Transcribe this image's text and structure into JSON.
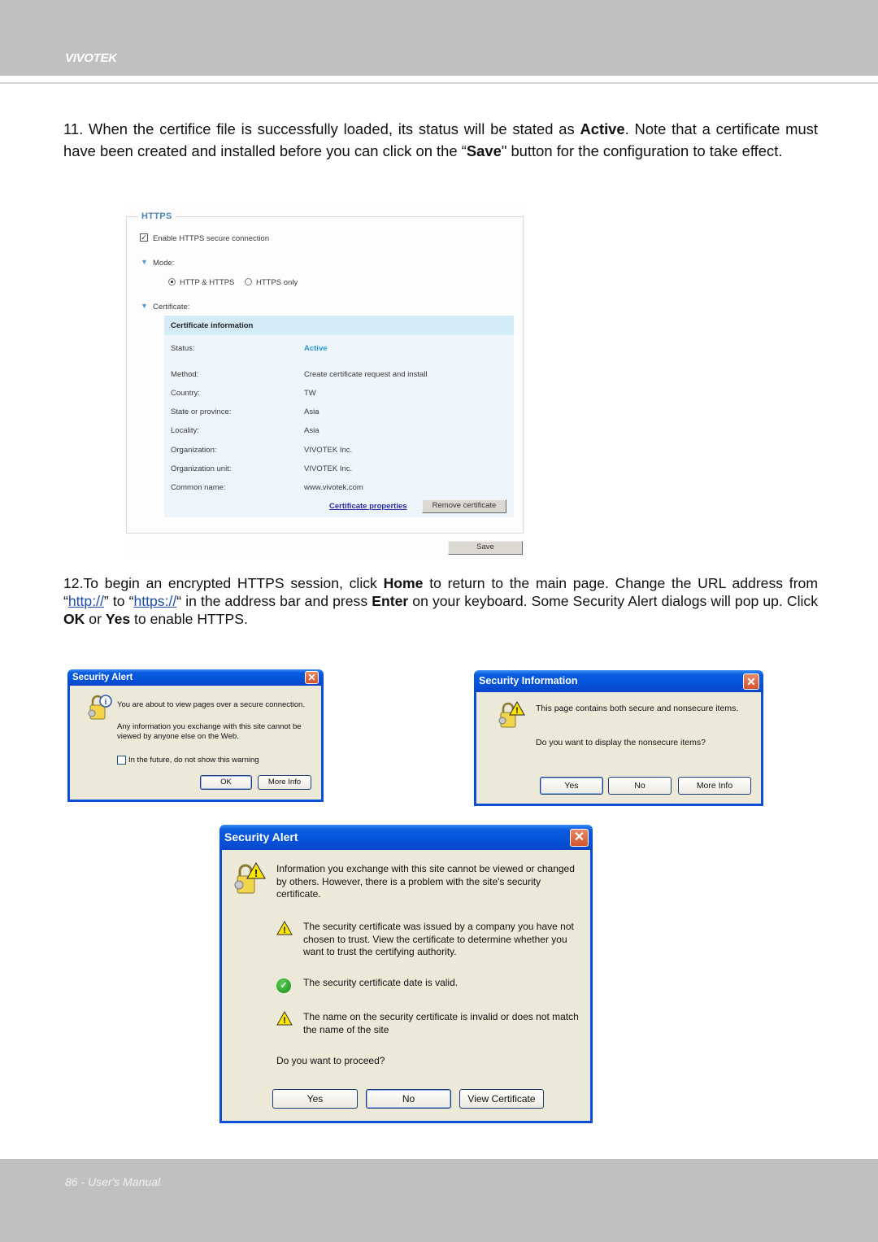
{
  "header": {
    "brand": "VIVOTEK"
  },
  "footer": {
    "page_label": "86 - User's Manual"
  },
  "step11": {
    "number": "11.",
    "text_a": " When the certifice file is successfully loaded, its status will be stated as ",
    "bold_active": "Active",
    "text_b": ". Note that a certificate must have been created and installed before you can click on the “",
    "bold_save": "Save",
    "text_c": "\" button for the configuration to take effect."
  },
  "https_panel": {
    "legend": "HTTPS",
    "enable_label": "Enable HTTPS secure connection",
    "enable_checked": true,
    "mode_label": "Mode:",
    "mode_options": [
      {
        "label": "HTTP & HTTPS",
        "selected": true
      },
      {
        "label": "HTTPS only",
        "selected": false
      }
    ],
    "certificate_label": "Certificate:",
    "cert_info_title": "Certificate information",
    "cert_rows": [
      {
        "label": "Status:",
        "value": "Active"
      },
      {
        "label": "Method:",
        "value": "Create certificate request and install"
      },
      {
        "label": "Country:",
        "value": "TW"
      },
      {
        "label": "State or province:",
        "value": "Asia"
      },
      {
        "label": "Locality:",
        "value": "Asia"
      },
      {
        "label": "Organization:",
        "value": "VIVOTEK Inc."
      },
      {
        "label": "Organization unit:",
        "value": "VIVOTEK Inc."
      },
      {
        "label": "Common name:",
        "value": "www.vivotek.com"
      }
    ],
    "cert_properties_link": "Certificate properties",
    "remove_cert_button": "Remove certificate",
    "save_button": "Save",
    "status_color": "#2a9ad6"
  },
  "step12": {
    "number": "12.",
    "text_a": "To begin an encrypted HTTPS session, click ",
    "bold_home": "Home",
    "text_b": " to return to the main page. Change the URL address from “",
    "link_http": "http://",
    "text_c": "” to “",
    "link_https": "https://",
    "text_d": "“ in the address bar and press ",
    "bold_enter": "Enter",
    "text_e": " on your keyboard. Some Security Alert dialogs will pop up. Click ",
    "bold_ok": "OK",
    "text_f": " or ",
    "bold_yes": "Yes",
    "text_g": " to enable HTTPS."
  },
  "dialog_security_alert_1": {
    "title": "Security Alert",
    "line1": "You are about to view pages over a secure connection.",
    "line2": "Any information you exchange with this site cannot be viewed by anyone else on the Web.",
    "checkbox_label": "In the future, do not show this warning",
    "checkbox_checked": false,
    "ok_button": "OK",
    "more_info_button": "More Info"
  },
  "dialog_security_information": {
    "title": "Security Information",
    "line1": "This page contains both secure and nonsecure items.",
    "line2": "Do you want to display the nonsecure items?",
    "yes_button": "Yes",
    "no_button": "No",
    "more_info_button": "More Info"
  },
  "dialog_security_alert_2": {
    "title": "Security Alert",
    "intro": "Information you exchange with this site cannot be viewed or changed by others. However, there is a problem with the site's security certificate.",
    "items": [
      {
        "icon": "warning-icon",
        "text": "The security certificate was issued by a company you have not chosen to trust. View the certificate to determine whether you want to trust the certifying authority."
      },
      {
        "icon": "check-icon",
        "text": "The security certificate date is valid."
      },
      {
        "icon": "warning-icon",
        "text": "The name on the security certificate is invalid or does not match the name of the site"
      }
    ],
    "question": "Do you want to proceed?",
    "yes_button": "Yes",
    "no_button": "No",
    "view_cert_button": "View Certificate"
  }
}
